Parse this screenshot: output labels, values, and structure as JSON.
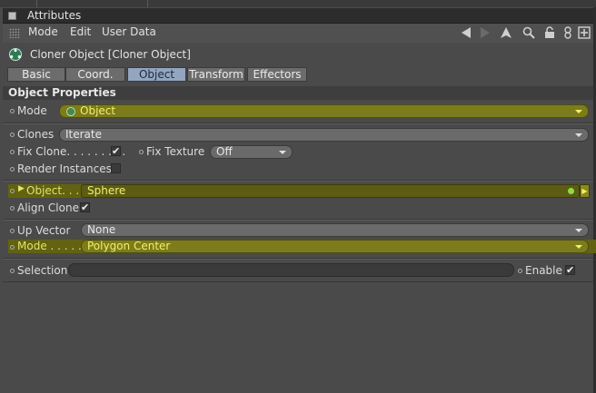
{
  "window": {
    "title": "Attributes"
  },
  "menu": {
    "mode": "Mode",
    "edit": "Edit",
    "user_data": "User Data"
  },
  "toolbar_icons": [
    "back-arrow-icon",
    "forward-arrow-icon",
    "up-arrow-icon",
    "search-icon",
    "lock-icon",
    "link-icon",
    "new-panel-icon"
  ],
  "object": {
    "title": "Cloner Object [Cloner Object]"
  },
  "tabs": [
    {
      "label": "Basic",
      "active": false
    },
    {
      "label": "Coord.",
      "active": false
    },
    {
      "label": "Object",
      "active": true
    },
    {
      "label": "Transform",
      "active": false
    },
    {
      "label": "Effectors",
      "active": false
    }
  ],
  "section": {
    "title": "Object Properties"
  },
  "props": {
    "mode": {
      "label": "Mode",
      "value": "Object"
    },
    "clones": {
      "label": "Clones",
      "value": "Iterate"
    },
    "fix_clone": {
      "label": "Fix Clone. . . . . . . . .",
      "checked": true
    },
    "fix_texture": {
      "label": "Fix Texture",
      "value": "Off"
    },
    "render_instances": {
      "label": "Render Instances",
      "checked": false
    },
    "object_link": {
      "label": "Object. . .",
      "value": "Sphere"
    },
    "align_clone": {
      "label": "Align Clone",
      "checked": true
    },
    "up_vector": {
      "label": "Up Vector",
      "value": "None"
    },
    "dist_mode": {
      "label": "Mode . . . . .",
      "value": "Polygon Center"
    },
    "selection": {
      "label": "Selection",
      "value": ""
    },
    "enable": {
      "label": "Enable",
      "checked": true
    }
  },
  "colors": {
    "highlight_text": "#e3e36a",
    "highlight_field": "#7c7c1a",
    "active_tab": "#93a6c0",
    "panel_bg": "#4a4a4a"
  }
}
